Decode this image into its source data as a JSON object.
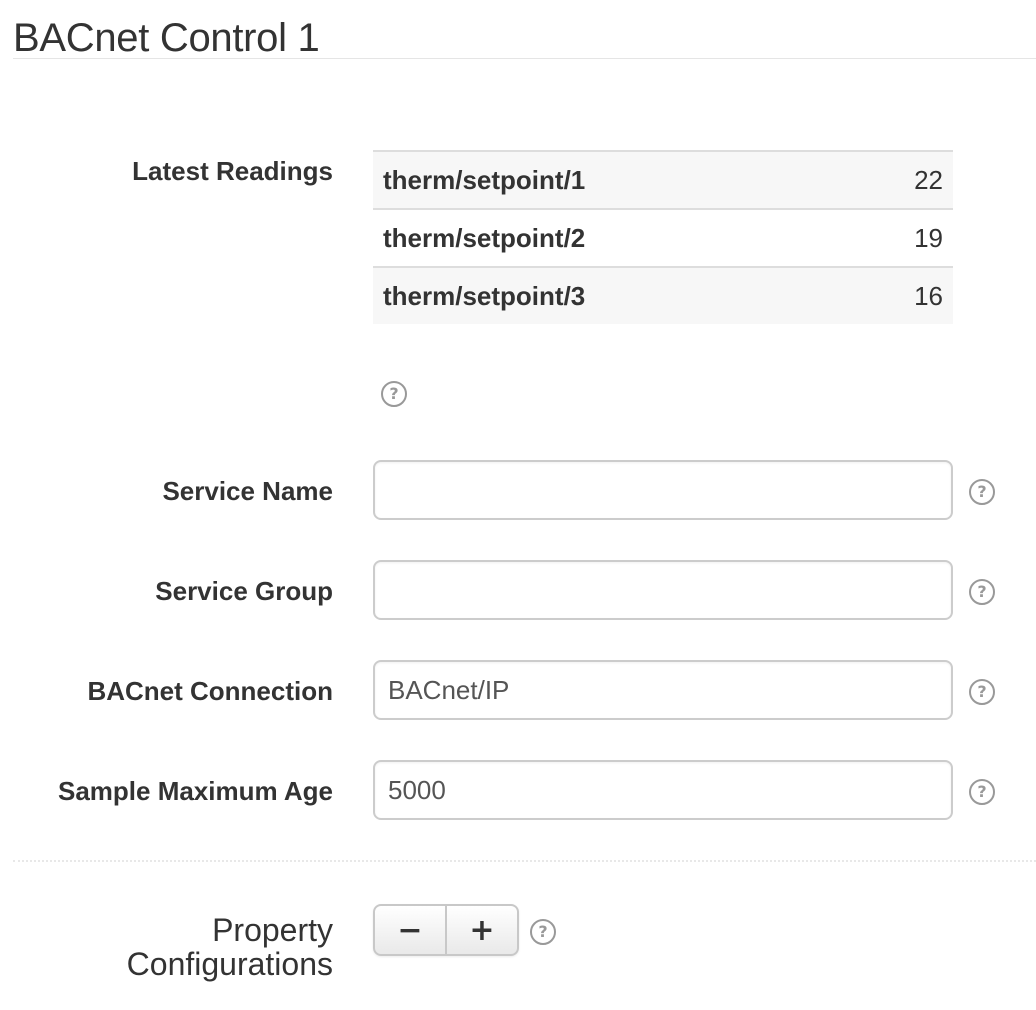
{
  "page": {
    "title": "BACnet Control 1"
  },
  "latest_readings": {
    "label": "Latest Readings",
    "rows": [
      {
        "property": "therm/setpoint/1",
        "value": "22"
      },
      {
        "property": "therm/setpoint/2",
        "value": "19"
      },
      {
        "property": "therm/setpoint/3",
        "value": "16"
      }
    ]
  },
  "help_icon_glyph": "?",
  "fields": {
    "service_name": {
      "label": "Service Name",
      "value": ""
    },
    "service_group": {
      "label": "Service Group",
      "value": ""
    },
    "bacnet_connection": {
      "label": "BACnet Connection",
      "value": "BACnet/IP"
    },
    "sample_maximum_age": {
      "label": "Sample Maximum Age",
      "value": "5000"
    }
  },
  "property_configurations": {
    "label": "Property Configurations",
    "remove_label": "−",
    "add_label": "+"
  },
  "icons": {
    "help": "question-circle-icon",
    "remove": "minus-icon",
    "add": "plus-icon"
  }
}
